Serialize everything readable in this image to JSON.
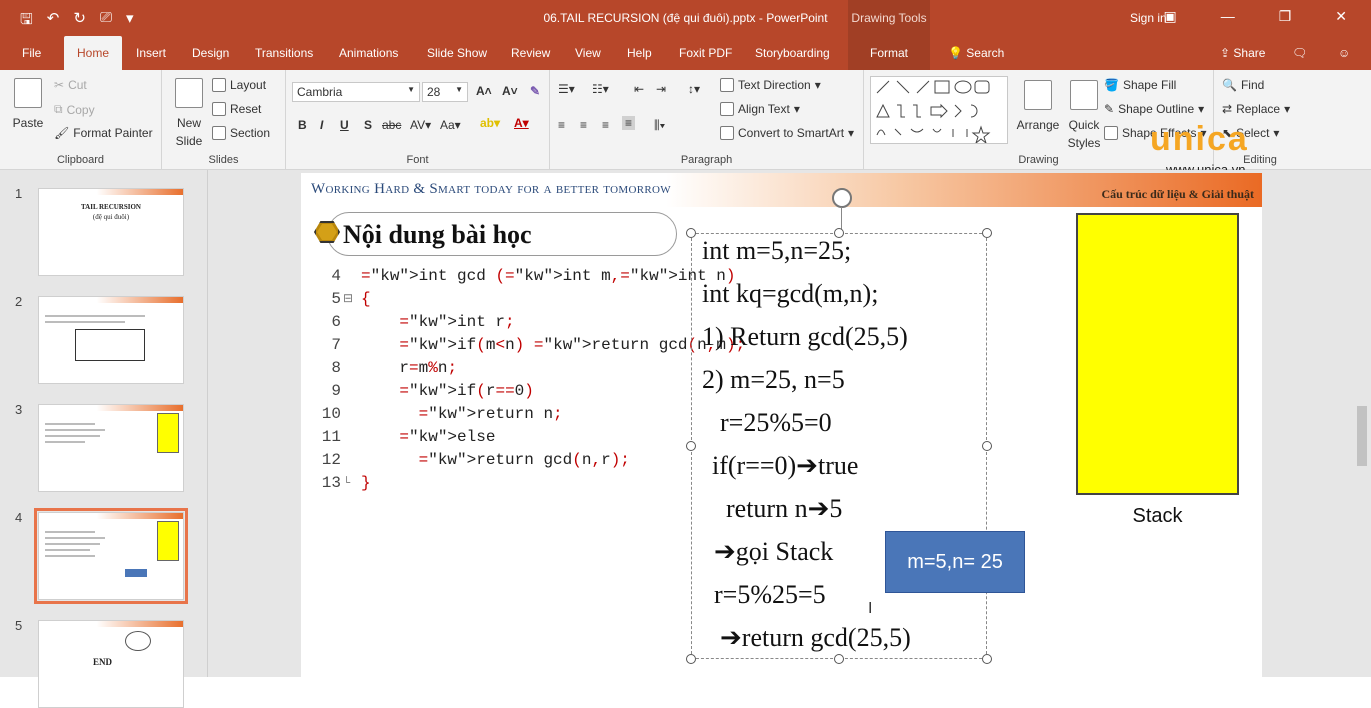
{
  "titlebar": {
    "document_title": "06.TAIL RECURSION (đệ qui đuôi).pptx - PowerPoint",
    "context_label": "Drawing Tools",
    "sign_in": "Sign in"
  },
  "tabs": [
    "File",
    "Home",
    "Insert",
    "Design",
    "Transitions",
    "Animations",
    "Slide Show",
    "Review",
    "View",
    "Help",
    "Foxit PDF",
    "Storyboarding",
    "Format"
  ],
  "tell_me": "Search",
  "share": "Share",
  "ribbon": {
    "clipboard": {
      "paste": "Paste",
      "cut": "Cut",
      "copy": "Copy",
      "format_painter": "Format Painter",
      "label": "Clipboard"
    },
    "slides": {
      "new_slide_line1": "New",
      "new_slide_line2": "Slide",
      "layout": "Layout",
      "reset": "Reset",
      "section": "Section",
      "label": "Slides"
    },
    "font": {
      "font_name": "Cambria",
      "font_size": "28",
      "label": "Font"
    },
    "paragraph": {
      "text_direction": "Text Direction",
      "align_text": "Align Text",
      "convert_smartart": "Convert to SmartArt",
      "label": "Paragraph"
    },
    "drawing": {
      "arrange": "Arrange",
      "quick_styles_line1": "Quick",
      "quick_styles_line2": "Styles",
      "shape_fill": "Shape Fill",
      "shape_outline": "Shape Outline",
      "shape_effects": "Shape Effects",
      "label": "Drawing"
    },
    "editing": {
      "find": "Find",
      "replace": "Replace",
      "select": "Select",
      "label": "Editing"
    }
  },
  "watermark": {
    "brand": "unica",
    "url": "www.unica.vn"
  },
  "thumbnails": {
    "numbers": [
      "1",
      "2",
      "3",
      "4",
      "5"
    ],
    "slide1_title": "TAIL RECURSION",
    "slide1_sub": "(đệ qui đuôi)",
    "slide5_text": "END",
    "active_index": 4
  },
  "slide": {
    "header_left": "Working Hard & Smart today for a better tomorrow",
    "header_right": "Cấu trúc dữ liệu & Giải thuật",
    "heading": "Nội dung bài học",
    "code_lines": [
      {
        "n": "4",
        "fold": "",
        "code": "int gcd (int m,int n)"
      },
      {
        "n": "5",
        "fold": "⊟",
        "code": "{"
      },
      {
        "n": "6",
        "fold": "",
        "code": "    int r;"
      },
      {
        "n": "7",
        "fold": "",
        "code": "    if(m<n) return gcd(n,m);"
      },
      {
        "n": "8",
        "fold": "",
        "code": "    r=m%n;"
      },
      {
        "n": "9",
        "fold": "",
        "code": "    if(r==0)"
      },
      {
        "n": "10",
        "fold": "",
        "code": "      return n;"
      },
      {
        "n": "11",
        "fold": "",
        "code": "    else"
      },
      {
        "n": "12",
        "fold": "",
        "code": "      return gcd(n,r);"
      },
      {
        "n": "13",
        "fold": "└",
        "code": "}"
      }
    ],
    "textbox_lines": [
      "int m=5,n=25;",
      "int kq=gcd(m,n);",
      "1) Return gcd(25,5)",
      "2) m=25, n=5",
      "r=25%5=0",
      "if(r==0)➔true",
      "return n➔5",
      "➔gọi Stack",
      "r=5%25=5",
      "➔return gcd(25,5)"
    ],
    "blue_box": "m=5,n= 25",
    "stack_label": "Stack"
  }
}
